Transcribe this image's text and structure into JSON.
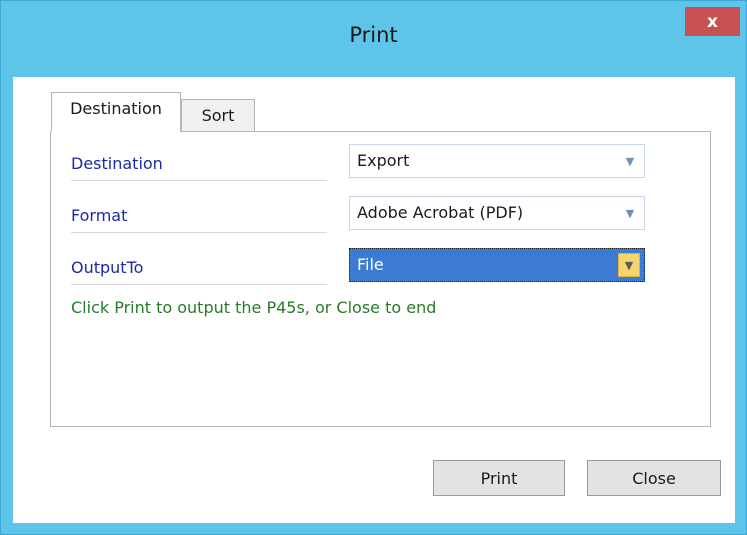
{
  "window": {
    "title": "Print",
    "close_glyph": "x"
  },
  "tabs": [
    {
      "label": "Destination",
      "active": true
    },
    {
      "label": "Sort",
      "active": false
    }
  ],
  "fields": {
    "destination": {
      "label": "Destination",
      "value": "Export"
    },
    "format": {
      "label": "Format",
      "value": "Adobe Acrobat (PDF)"
    },
    "output_to": {
      "label": "OutputTo",
      "value": "File"
    }
  },
  "hint": "Click Print to output the P45s, or Close to end",
  "buttons": {
    "print": "Print",
    "close": "Close"
  },
  "icons": {
    "close": "close-icon",
    "dropdown": "chevron-down-icon"
  },
  "colors": {
    "titlebar": "#5ec4ea",
    "close_button": "#c75050",
    "label_text": "#1d2aa5",
    "hint_text": "#2a7a2a",
    "selection": "#3b7bd2"
  }
}
